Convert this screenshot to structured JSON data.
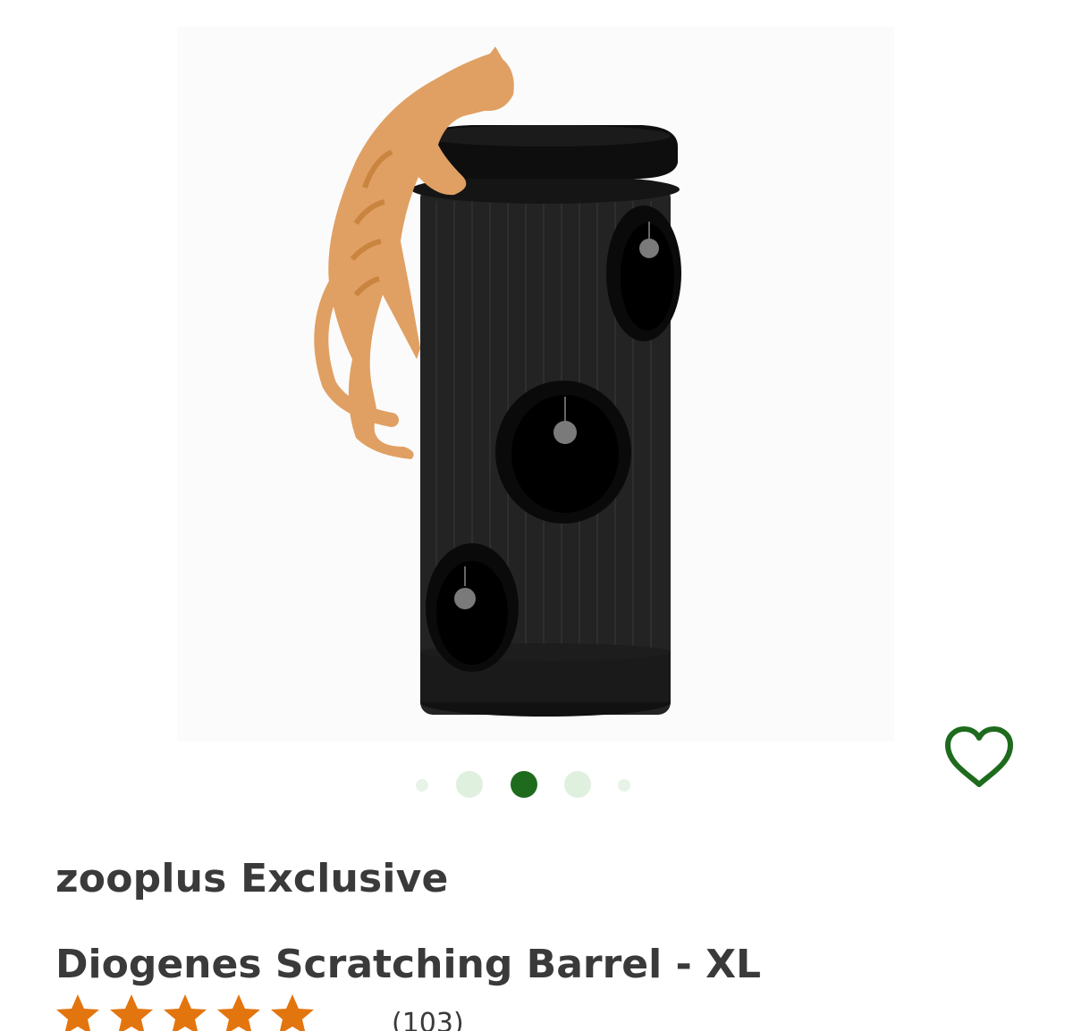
{
  "product": {
    "brand": "zooplus Exclusive",
    "title": "Diogenes Scratching Barrel - XL",
    "review_count": "(103)",
    "rating": 5,
    "rating_max": 5
  },
  "carousel": {
    "slide_count": 5,
    "active_index": 2
  },
  "icons": {
    "wishlist": "heart-outline-icon",
    "rating_star": "star-icon"
  },
  "colors": {
    "accent_green": "#1e6b1e",
    "dot_inactive": "#dff0df",
    "star_orange": "#e3750e",
    "text": "#3a3a3a"
  }
}
